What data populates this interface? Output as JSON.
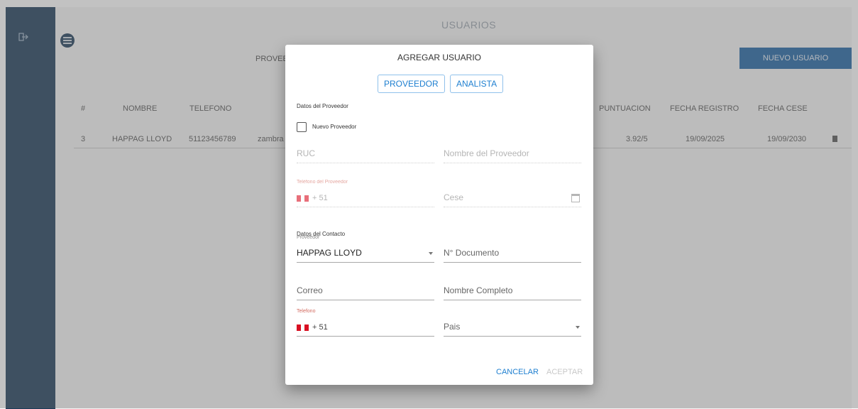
{
  "page": {
    "title": "USUARIOS"
  },
  "sidebar": {
    "logout_icon": "logout-icon",
    "menu_icon": "list-icon"
  },
  "toolbar": {
    "filter_label": "PROVEE",
    "new_user_label": "NUEVO USUARIO"
  },
  "table": {
    "columns": [
      "#",
      "NOMBRE",
      "TELEFONO",
      "PUNTUACION",
      "FECHA REGISTRO",
      "FECHA CESE"
    ],
    "rows": [
      {
        "num": "3",
        "nombre": "HAPPAG LLOYD",
        "telefono": "51123456789",
        "partial": "zambra",
        "puntuacion": "3.92/5",
        "fecha_registro": "19/09/2025",
        "fecha_cese": "19/09/2030"
      }
    ]
  },
  "dialog": {
    "title": "AGREGAR USUARIO",
    "tabs": [
      "PROVEEDOR",
      "ANALISTA"
    ],
    "provider_section": "Datos del Proveedor",
    "new_provider_label": "Nuevo Proveedor",
    "ruc_placeholder": "RUC",
    "provider_name_placeholder": "Nombre del Proveedor",
    "provider_phone_label": "Teléfono del Proveedor",
    "phone_code": "+ 51",
    "cese_placeholder": "Cese",
    "contact_section": "Datos del Contacto",
    "provider_select_label": "Proveedor",
    "provider_select_value": "HAPPAG LLOYD",
    "document_placeholder": "N° Documento",
    "email_placeholder": "Correo",
    "full_name_placeholder": "Nombre Completo",
    "phone_label": "Telefono",
    "country_placeholder": "Pais",
    "cancel_label": "CANCELAR",
    "accept_label": "ACEPTAR"
  },
  "colors": {
    "sidebar": "#1d3b58",
    "primary": "#1e62a3",
    "accent": "#1e7fd0",
    "flag_red": "#d91023"
  }
}
